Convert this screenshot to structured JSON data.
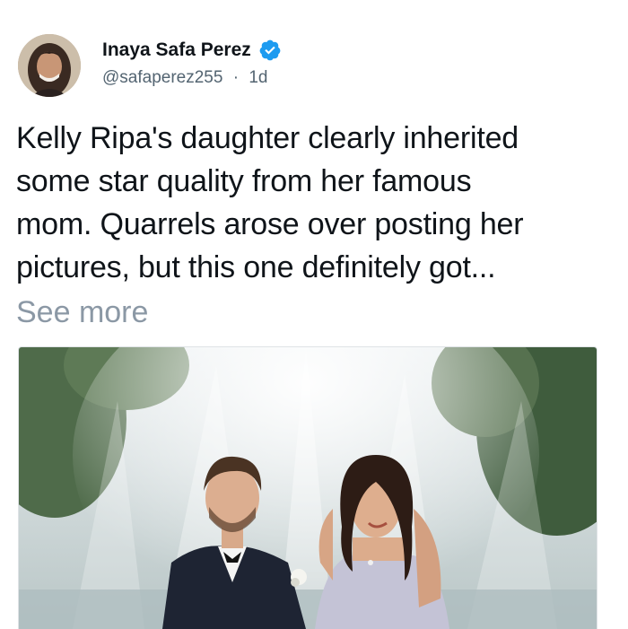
{
  "author": {
    "display_name": "Inaya Safa Perez",
    "handle": "@safaperez255",
    "separator": "·",
    "time_ago": "1d",
    "verified": true,
    "verified_icon": "verified-badge-icon"
  },
  "tweet": {
    "lines": [
      "Kelly Ripa's daughter clearly inherited",
      "some star quality from her famous",
      "mom. Quarrels arose over posting her",
      "pictures, but this one definitely got..."
    ],
    "see_more_label": "See more"
  },
  "media": {
    "description_icon": "photo-couple-fountain"
  },
  "colors": {
    "text": "#0f1419",
    "secondary": "#536471",
    "muted": "#8b98a5",
    "verified_blue": "#1d9bf0"
  }
}
